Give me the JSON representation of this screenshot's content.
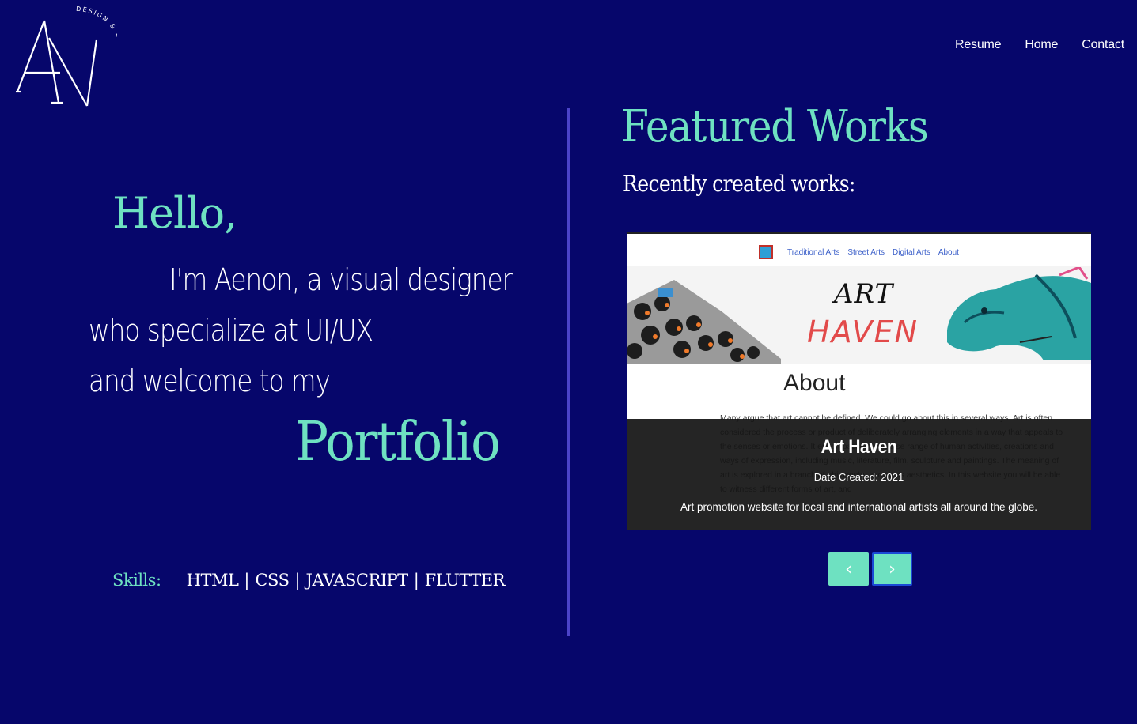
{
  "logo": {
    "initials": "AN",
    "tagline": "DESIGN & CREATE"
  },
  "nav": {
    "items": [
      "Resume",
      "Home",
      "Contact"
    ]
  },
  "intro": {
    "greeting": "Hello,",
    "line1": "I'm Aenon, a visual designer",
    "line2": "who specialize at UI/UX",
    "line3": "and welcome to my",
    "highlight": "Portfolio"
  },
  "skills": {
    "label": "Skills:",
    "items": [
      "HTML",
      "CSS",
      "JAVASCRIPT",
      "FLUTTER"
    ],
    "separator": "|"
  },
  "featured": {
    "title": "Featured Works",
    "subtitle": "Recently created works:"
  },
  "carousel": {
    "current": {
      "site_nav": [
        "Traditional Arts",
        "Street Arts",
        "Digital Arts",
        "About"
      ],
      "banner_word1": "ART",
      "banner_word2": "HAVEN",
      "about_heading": "About",
      "faded_text": "Many argue that art cannot be defined. We could go about this in several ways. Art is often considered the process or product of deliberately arranging elements in a way that appeals to the senses or emotions. It encompasses a diverse range of human activities, creations and ways of expression, including music, literature, film, sculpture and paintings. The meaning of art is explored in a branch of philosophy known as aesthetics. In this website you will be able to witness different forms of art, and",
      "title": "Art Haven",
      "date": "Date Created: 2021",
      "description": "Art promotion website for local and international artists all around the globe."
    },
    "prev_label": "‹",
    "next_label": "›"
  },
  "colors": {
    "background": "#06066b",
    "accent": "#6ee1c1",
    "divider": "#4b43c9"
  }
}
